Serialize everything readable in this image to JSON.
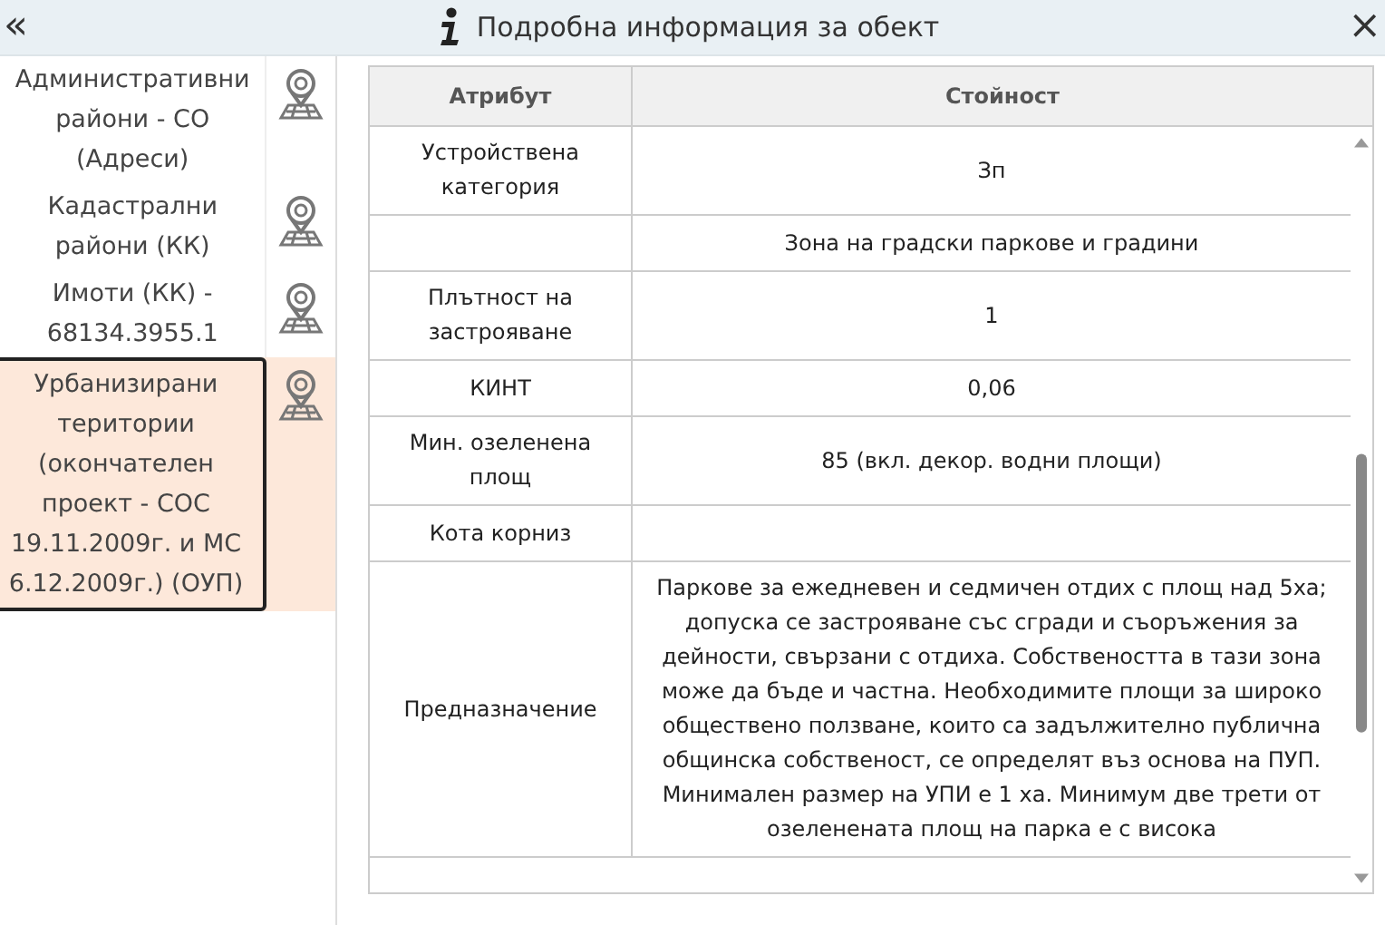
{
  "header": {
    "collapse": "«",
    "title": "Подробна информация за обект",
    "close": "×"
  },
  "layers": [
    {
      "label": "Административни райони - СО (Адреси)",
      "selected": false
    },
    {
      "label": "Кадастрални райони (КК)",
      "selected": false
    },
    {
      "label": "Имоти (КК) - 68134.3955.1",
      "selected": false
    },
    {
      "label": "Урбанизирани територии (окончателен проект - СОС 19.11.2009г. и МС 6.12.2009г.) (ОУП)",
      "selected": true
    }
  ],
  "table": {
    "columns": [
      "Атрибут",
      "Стойност"
    ],
    "rows": [
      {
        "attribute": "Устройствена категория",
        "value": "Зп"
      },
      {
        "attribute": "",
        "value": "Зона на градски паркове и градини"
      },
      {
        "attribute": "Плътност на застрояване",
        "value": "1"
      },
      {
        "attribute": "КИНТ",
        "value": "0,06"
      },
      {
        "attribute": "Мин. озеленена площ",
        "value": "85 (вкл. декор. водни площи)"
      },
      {
        "attribute": "Кота корниз",
        "value": ""
      },
      {
        "attribute": "Предназначение",
        "value": "Паркове за ежедневен и седмичен отдих с площ над 5ха; допуска се застрояване със сгради и съоръжения за дейности, свързани с отдиха. Собствеността в тази зона може да бъде и частна. Необходимите площи за широко обществено ползване, които са задължително публична общинска собственост, се определят въз основа на ПУП. Минимален размер на УПИ е 1 ха. Минимум две трети от озеленената площ на парка е с висока"
      }
    ]
  }
}
